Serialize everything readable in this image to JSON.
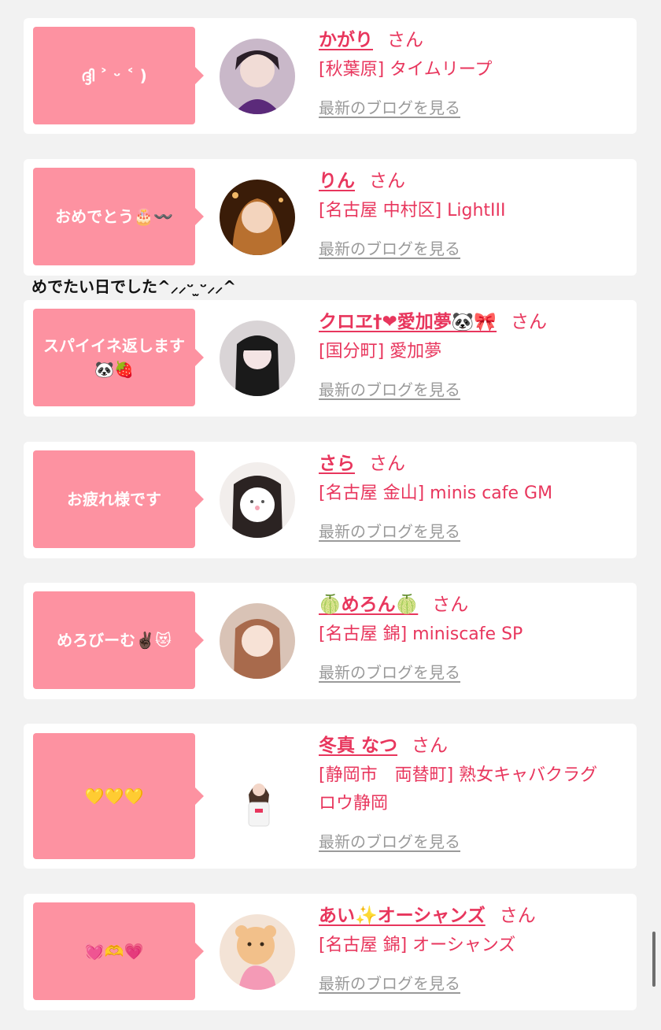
{
  "entries": [
    {
      "message": "ദ്ദി ˃ ᵕ ˂ )",
      "name": "かがり",
      "honorific": "さん",
      "shop": "[秋葉原] タイムリープ",
      "blog_link": "最新のブログを見る",
      "avatar_colors": [
        "#3a2b3a",
        "#c9b8c9"
      ]
    },
    {
      "message": "おめでとう🎂〰️",
      "name": "りん",
      "honorific": "さん",
      "shop": "[名古屋 中村区] LightIII",
      "blog_link": "最新のブログを見る",
      "avatar_colors": [
        "#3a1c08",
        "#c8894a"
      ]
    },
    {
      "message": "スパイイネ返します🐼🍓",
      "name": "クロヱ†❤愛加夢🐼🎀",
      "honorific": "さん",
      "shop": "[国分町] 愛加夢",
      "blog_link": "最新のブログを見る",
      "avatar_colors": [
        "#222222",
        "#d9d4d6"
      ]
    },
    {
      "message": "お疲れ様です",
      "name": "さら",
      "honorific": "さん",
      "shop": "[名古屋 金山] minis cafe GM",
      "blog_link": "最新のブログを見る",
      "avatar_colors": [
        "#dedad8",
        "#f6f1ee"
      ]
    },
    {
      "message": "めろびーむ✌🏿😻",
      "name": "🍈めろん🍈",
      "honorific": "さん",
      "shop": "[名古屋 錦] miniscafe SP",
      "blog_link": "最新のブログを見る",
      "avatar_colors": [
        "#b98a6c",
        "#f0ddd0"
      ]
    },
    {
      "message": "💛💛💛",
      "name": "冬真 なつ",
      "honorific": "さん",
      "shop": "[静岡市　両替町] 熟女キャバクラグロウ静岡",
      "blog_link": "最新のブログを見る",
      "avatar_colors": [
        "#ffffff",
        "#e8e2e0"
      ]
    },
    {
      "message": "💓🫶💗",
      "name": "あい✨オーシャンズ",
      "honorific": "さん",
      "shop": "[名古屋 錦] オーシャンズ",
      "blog_link": "最新のブログを見る",
      "avatar_colors": [
        "#f7c98f",
        "#f3a3b5"
      ]
    }
  ],
  "floating_text": "めでたい日でした^⸝⸝ᵕ ̫ᵕ⸝⸝^",
  "colors": {
    "background": "#f2f2f2",
    "card": "#ffffff",
    "bubble": "#fd92a1",
    "accent": "#e8365d",
    "link_gray": "#9a9a9a"
  }
}
